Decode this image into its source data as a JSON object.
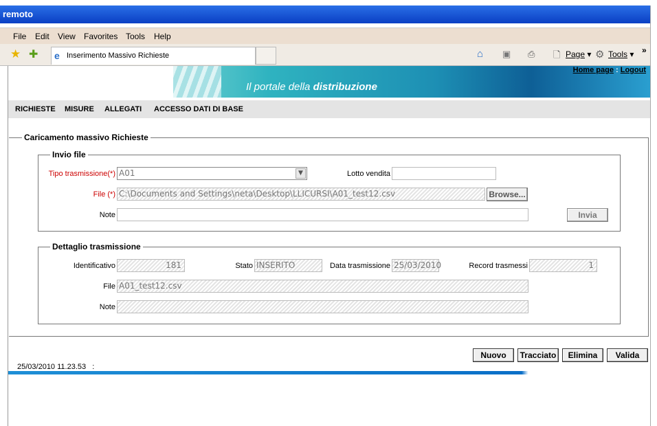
{
  "window": {
    "title": "remoto"
  },
  "menu": {
    "items": [
      "File",
      "Edit",
      "View",
      "Favorites",
      "Tools",
      "Help"
    ]
  },
  "toolbar": {
    "tab_title": "Inserimento Massivo Richieste",
    "page_label": "Page",
    "tools_label": "Tools"
  },
  "banner": {
    "portal_text": "Il portale della",
    "portal_bold": "distribuzione",
    "home_link": "Home page",
    "separator": ":",
    "logout_link": "Logout"
  },
  "nav": {
    "items": [
      "RICHIESTE",
      "MISURE",
      "ALLEGATI",
      "ACCESSO DATI DI BASE"
    ]
  },
  "main": {
    "section_title": "Caricamento massivo Richieste",
    "invio": {
      "title": "Invio file",
      "tipo_label": "Tipo trasmissione(*)",
      "tipo_value": "A01",
      "lotto_label": "Lotto vendita",
      "lotto_value": "",
      "file_label": "File (*)",
      "file_value": "C:\\Documents and Settings\\neta\\Desktop\\LLICURSI\\A01_test12.csv",
      "browse_label": "Browse...",
      "note_label": "Note",
      "note_value": "",
      "invia_label": "Invia"
    },
    "dettaglio": {
      "title": "Dettaglio trasmissione",
      "id_label": "Identificativo",
      "id_value": "181",
      "stato_label": "Stato",
      "stato_value": "INSERITO",
      "data_label": "Data trasmissione",
      "data_value": "25/03/2010",
      "record_label": "Record trasmessi",
      "record_value": "1",
      "file_label": "File",
      "file_value": "A01_test12.csv",
      "note_label": "Note",
      "note_value": ""
    }
  },
  "actions": {
    "nuovo": "Nuovo",
    "tracciato": "Tracciato",
    "elimina": "Elimina",
    "valida": "Valida"
  },
  "status": {
    "timestamp": "25/03/2010 11.23.53",
    "suffix": ":"
  }
}
